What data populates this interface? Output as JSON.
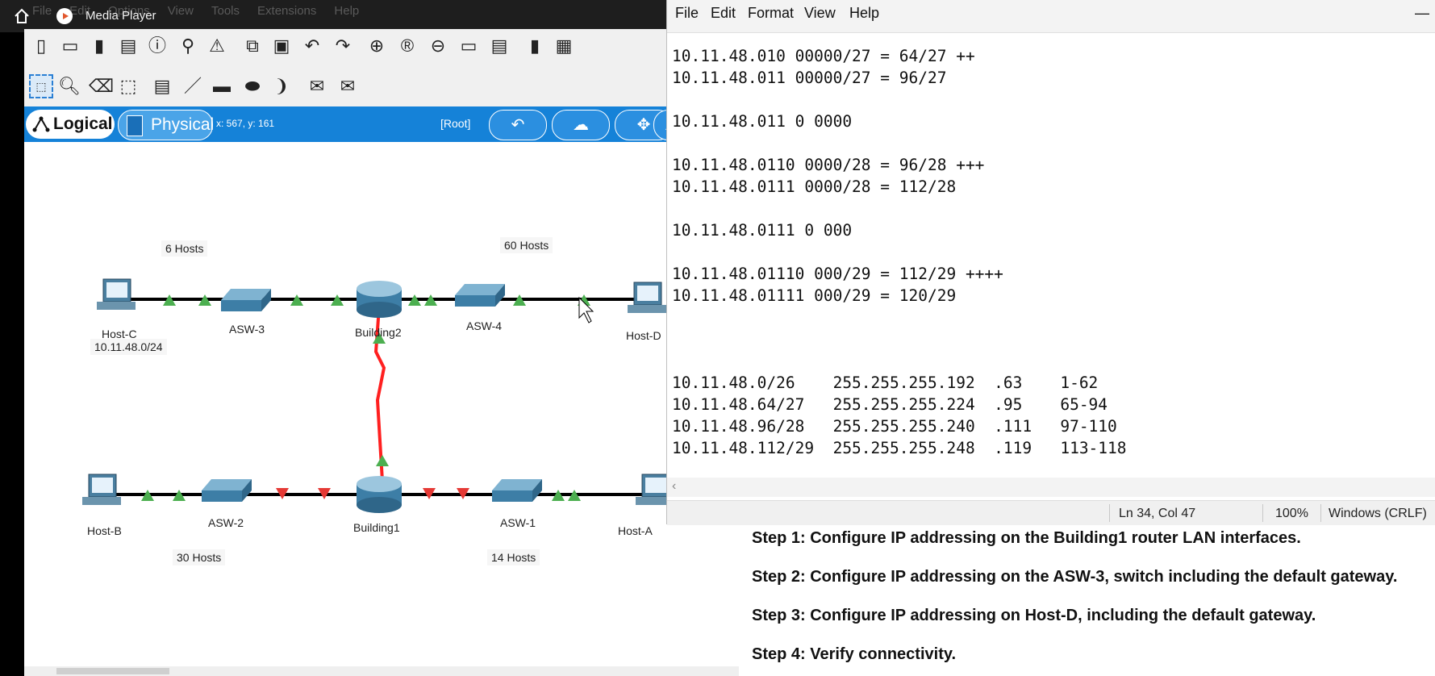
{
  "media_player": {
    "title": "Media Player"
  },
  "pt_menus": [
    "File",
    "Edit",
    "Options",
    "View",
    "Tools",
    "Extensions",
    "Help"
  ],
  "bluebar": {
    "logical": "Logical",
    "physical": "Physical",
    "coords": "x: 567, y: 161",
    "root": "[Root]"
  },
  "topology": {
    "labels": {
      "hosts6": "6 Hosts",
      "hosts60": "60 Hosts",
      "network": "10.11.48.0/24",
      "hosts30": "30 Hosts",
      "hosts14": "14 Hosts"
    },
    "devices": {
      "host_c": "Host-C",
      "asw3": "ASW-3",
      "building2": "Building2",
      "asw4": "ASW-4",
      "host_d": "Host-D",
      "host_b": "Host-B",
      "asw2": "ASW-2",
      "building1": "Building1",
      "asw1": "ASW-1",
      "host_a": "Host-A"
    },
    "colors": {
      "link_up": "#4caf50",
      "link_down": "#e53935",
      "serial": "#ff2020"
    }
  },
  "notepad": {
    "menu": [
      "File",
      "Edit",
      "Format",
      "View",
      "Help"
    ],
    "lines": [
      "10.11.48.010 00000/27 = 64/27 ++",
      "10.11.48.011 00000/27 = 96/27",
      "",
      "10.11.48.011 0 0000",
      "",
      "10.11.48.0110 0000/28 = 96/28 +++",
      "10.11.48.0111 0000/28 = 112/28",
      "",
      "10.11.48.0111 0 000",
      "",
      "10.11.48.01110 000/29 = 112/29 ++++",
      "10.11.48.01111 000/29 = 120/29",
      "",
      "",
      "",
      "10.11.48.0/26    255.255.255.192  .63    1-62",
      "10.11.48.64/27   255.255.255.224  .95    65-94",
      "10.11.48.96/28   255.255.255.240  .111   97-110",
      "10.11.48.112/29  255.255.255.248  .119   113-118"
    ],
    "status": {
      "position": "Ln 34, Col 47",
      "zoom": "100%",
      "eol": "Windows (CRLF)"
    }
  },
  "instructions": {
    "step1": "Step 1: Configure IP addressing on the Building1 router LAN interfaces.",
    "step2": "Step 2: Configure IP addressing on the ASW-3, switch including the default gateway.",
    "step3": "Step 3: Configure IP addressing on Host-D, including the default gateway.",
    "step4": "Step 4: Verify connectivity."
  }
}
